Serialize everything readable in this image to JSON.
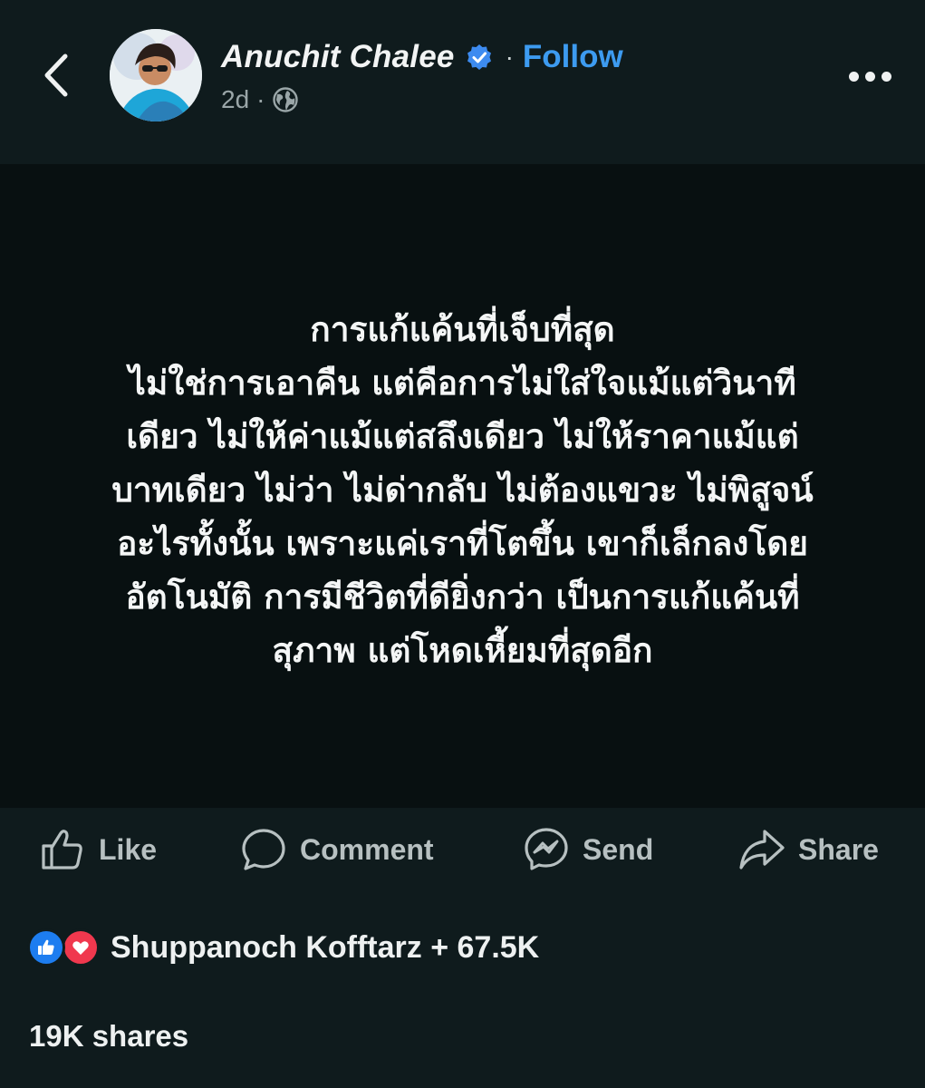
{
  "header": {
    "author_name": "Anuchit Chalee",
    "separator": "·",
    "follow_label": "Follow",
    "time_ago": "2d",
    "meta_separator": "·",
    "icons": {
      "back": "chevron-left-icon",
      "verified": "verified-badge-icon",
      "audience": "globe-icon",
      "more": "more-dots-icon"
    },
    "colors": {
      "follow": "#3d9bf0",
      "verified": "#3d8bf0"
    }
  },
  "post": {
    "text": "การแก้แค้นที่เจ็บที่สุด\nไม่ใช่การเอาคืน แต่คือการไม่ใส่ใจแม้แต่วินาที\nเดียว ไม่ให้ค่าแม้แต่สลึงเดียว ไม่ให้ราคาแม้แต่\nบาทเดียว ไม่ว่า ไม่ด่ากลับ ไม่ต้องแขวะ ไม่พิสูจน์\nอะไรทั้งนั้น เพราะแค่เราที่โตขึ้น เขาก็เล็กลงโดย\nอัตโนมัติ การมีชีวิตที่ดียิ่งกว่า เป็นการแก้แค้นที่\nสุภาพ แต่โหดเหี้ยมที่สุดอีก",
    "background": "#081011"
  },
  "actions": {
    "like": "Like",
    "comment": "Comment",
    "send": "Send",
    "share": "Share"
  },
  "reactions": {
    "summary": "Shuppanoch Kofftarz + 67.5K",
    "types": [
      "like",
      "love"
    ]
  },
  "shares": "19K shares"
}
